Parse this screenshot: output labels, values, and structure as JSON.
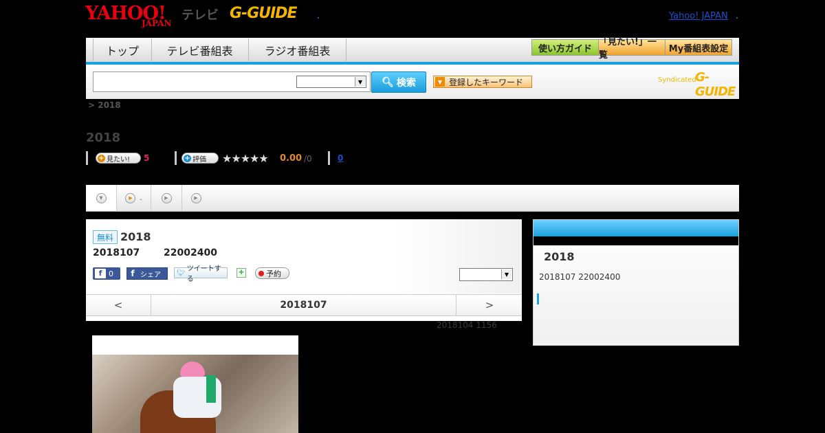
{
  "header": {
    "logo_yahoo": "YAHOO!",
    "logo_japan": "JAPAN",
    "logo_tv": "テレビ",
    "logo_gguide": "G-GUIDE",
    "yahoo_japan_link": "Yahoo! JAPAN"
  },
  "nav": {
    "tabs": [
      "トップ",
      "テレビ番組表",
      "ラジオ番組表"
    ],
    "guide_buttons": [
      "使い方ガイド",
      "「見たい!」一覧",
      "My番組表設定"
    ]
  },
  "search": {
    "placeholder": "",
    "button_label": "検索",
    "keywords_label": "登録したキーワード",
    "syndicated_label": "Syndicated",
    "syndicated_brand": "G-GUIDE"
  },
  "breadcrumb": "> 2018",
  "page_title": "2018",
  "ratings": {
    "want_label": "見たい!",
    "want_count": "5",
    "rate_label": "評価",
    "stars": 0,
    "score": "0.00",
    "score_count": "/0",
    "count_link": "0"
  },
  "tabs": [
    {
      "label": ""
    },
    {
      "label": "."
    },
    {
      "label": ""
    },
    {
      "label": ""
    }
  ],
  "program": {
    "free_badge": "無料",
    "title": "2018",
    "date": "2018107",
    "time": "22002400",
    "fb_like_count": "0",
    "fb_share_label": "シェア",
    "tweet_label": "ツイートする",
    "reserve_label": "予約",
    "day_nav": {
      "prev": "<",
      "date": "2018107",
      "next": ">"
    },
    "meta": "2018104  1156"
  },
  "sidebar": {
    "title": "2018",
    "date": "2018107  22002400"
  },
  "colors": {
    "accent": "#1aa0dc",
    "brand_red": "#e60012",
    "gguide_yellow": "#f2b500"
  }
}
